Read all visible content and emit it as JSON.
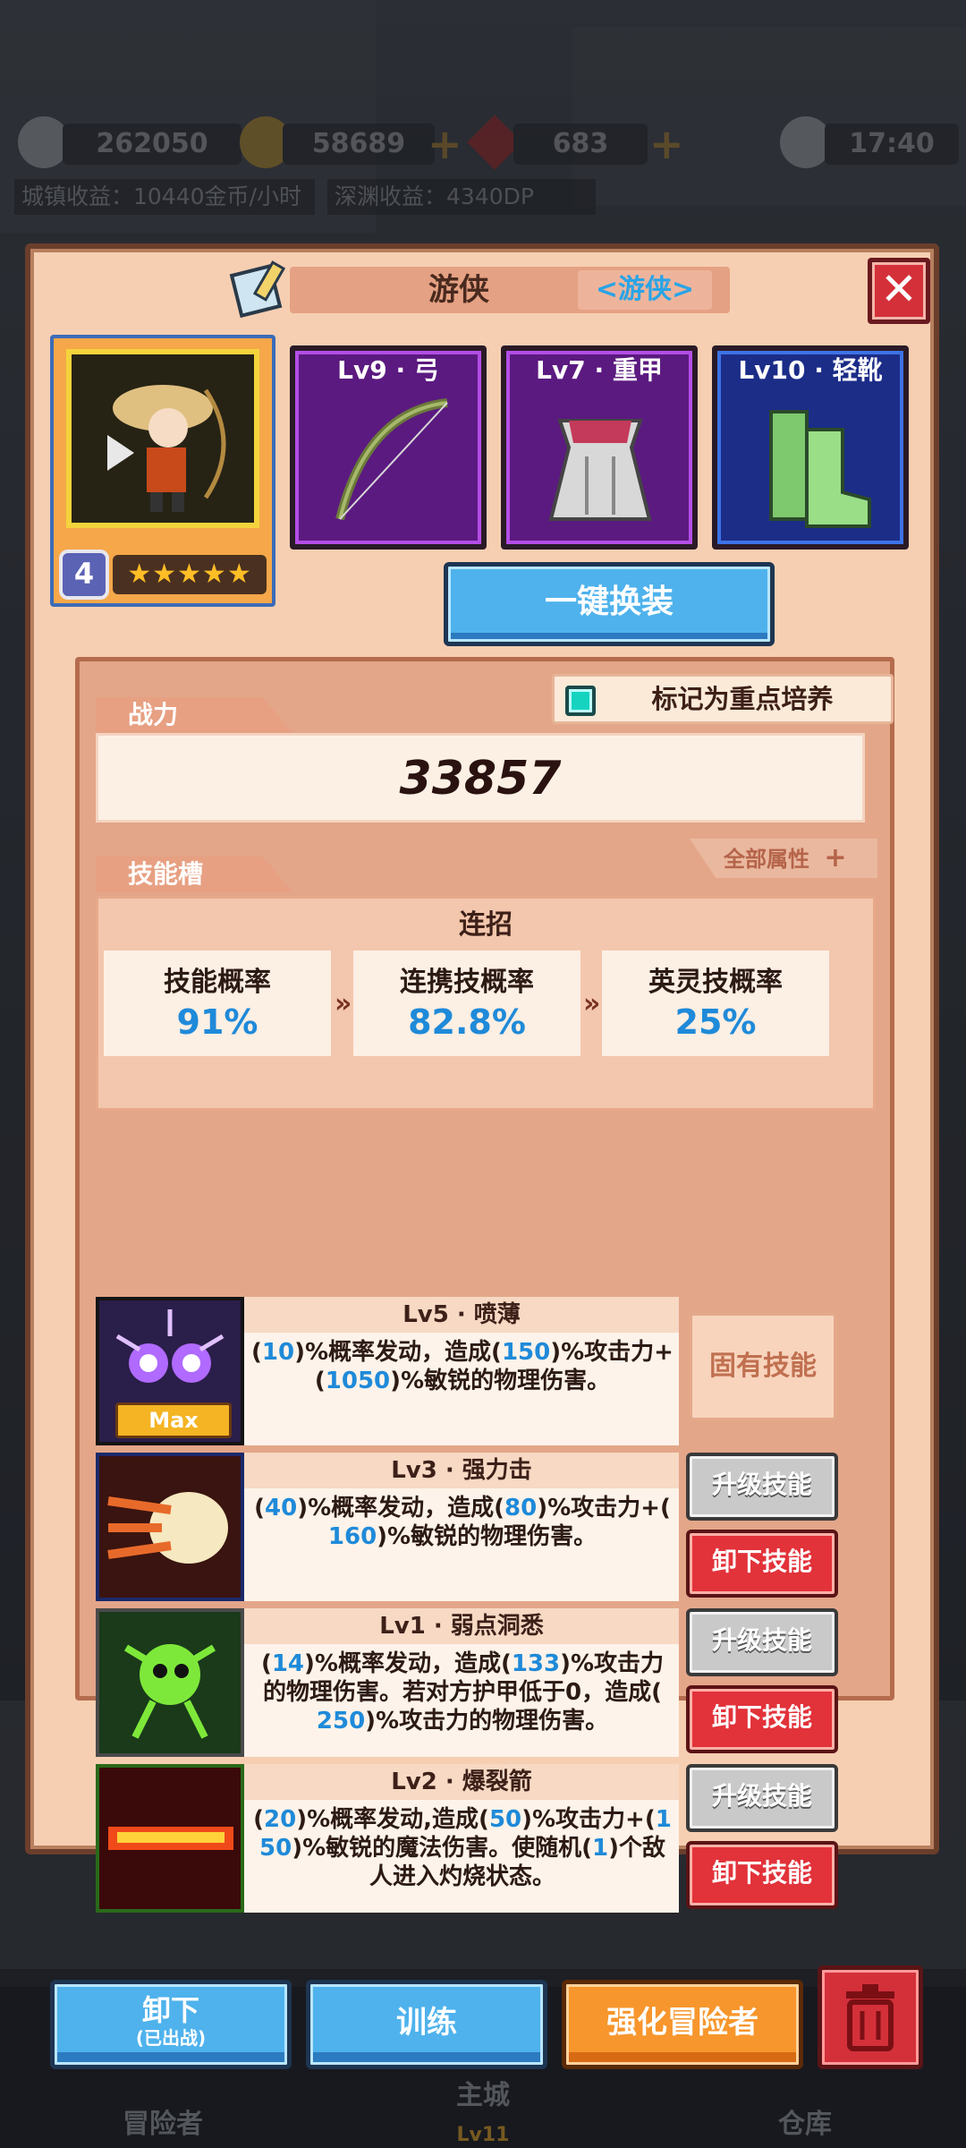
{
  "topbar": {
    "resource1": "262050",
    "resource2": "58689",
    "resource3": "683",
    "clock": "17:40",
    "town_income": "城镇收益：10440金币/小时",
    "abyss_income": "深渊收益：4340DP"
  },
  "bottom_nav": {
    "adventurers": "冒险者",
    "main_city": "主城",
    "main_city_level": "Lv11",
    "warehouse": "仓库"
  },
  "dialog": {
    "title": "游侠",
    "class_tag": "<游侠>",
    "hero_level": "4",
    "stars": "★★★★★",
    "equipment": [
      {
        "label": "Lv9 · 弓",
        "icon": "bow-icon"
      },
      {
        "label": "Lv7 · 重甲",
        "icon": "heavy-armor-icon"
      },
      {
        "label": "Lv10 · 轻靴",
        "icon": "light-boots-icon"
      }
    ],
    "swap_button": "一键换装",
    "power_tab": "战力",
    "focus_label": "标记为重点培养",
    "power_value": "33857",
    "skill_tab": "技能槽",
    "all_attributes": "全部属性",
    "combo": {
      "title": "连招",
      "cells": [
        {
          "name": "技能概率",
          "value": "91%"
        },
        {
          "name": "连携技概率",
          "value": "82.8%"
        },
        {
          "name": "英灵技概率",
          "value": "25%"
        }
      ]
    },
    "skills": [
      {
        "title": "Lv5 · 喷薄",
        "line1": [
          "(",
          "10",
          ")%概率发动，造成(",
          "150",
          ")%攻击力+"
        ],
        "line2": [
          "(",
          "1050",
          ")%敏锐的物理伤害。"
        ],
        "line3": [],
        "badge": "Max",
        "fixed": "固有技能"
      },
      {
        "title": "Lv3 · 强力击",
        "line1": [
          "(",
          "40",
          ")%概率发动，造成(",
          "80",
          ")%攻击力+("
        ],
        "line2": [
          "",
          "160",
          ")%敏锐的物理伤害。"
        ],
        "line3": [],
        "upgrade": "升级技能",
        "unequip": "卸下技能"
      },
      {
        "title": "Lv1 · 弱点洞悉",
        "line1": [
          "(",
          "14",
          ")%概率发动，造成(",
          "133",
          ")%攻击力"
        ],
        "line2": [
          "的物理伤害。若对方护甲低于0，造成("
        ],
        "line3": [
          "",
          "250",
          ")%攻击力的物理伤害。"
        ],
        "upgrade": "升级技能",
        "unequip": "卸下技能"
      },
      {
        "title": "Lv2 · 爆裂箭",
        "line1": [
          "(",
          "20",
          ")%概率发动,造成(",
          "50",
          ")%攻击力+(",
          "1",
          ""
        ],
        "line2": [
          "",
          "50",
          ")%敏锐的魔法伤害。使随机(",
          "1",
          ")个敌"
        ],
        "line3": [
          "人进入灼烧状态。"
        ],
        "upgrade": "升级技能",
        "unequip": "卸下技能"
      }
    ],
    "buttons": {
      "unequip_main": "卸下",
      "unequip_sub": "(已出战)",
      "train": "训练",
      "enhance": "强化冒险者"
    }
  },
  "colors": {
    "panel": "#f6cfb2",
    "accent_blue": "#1f8ad9",
    "danger_red": "#e2323a",
    "orange": "#f7962c"
  }
}
